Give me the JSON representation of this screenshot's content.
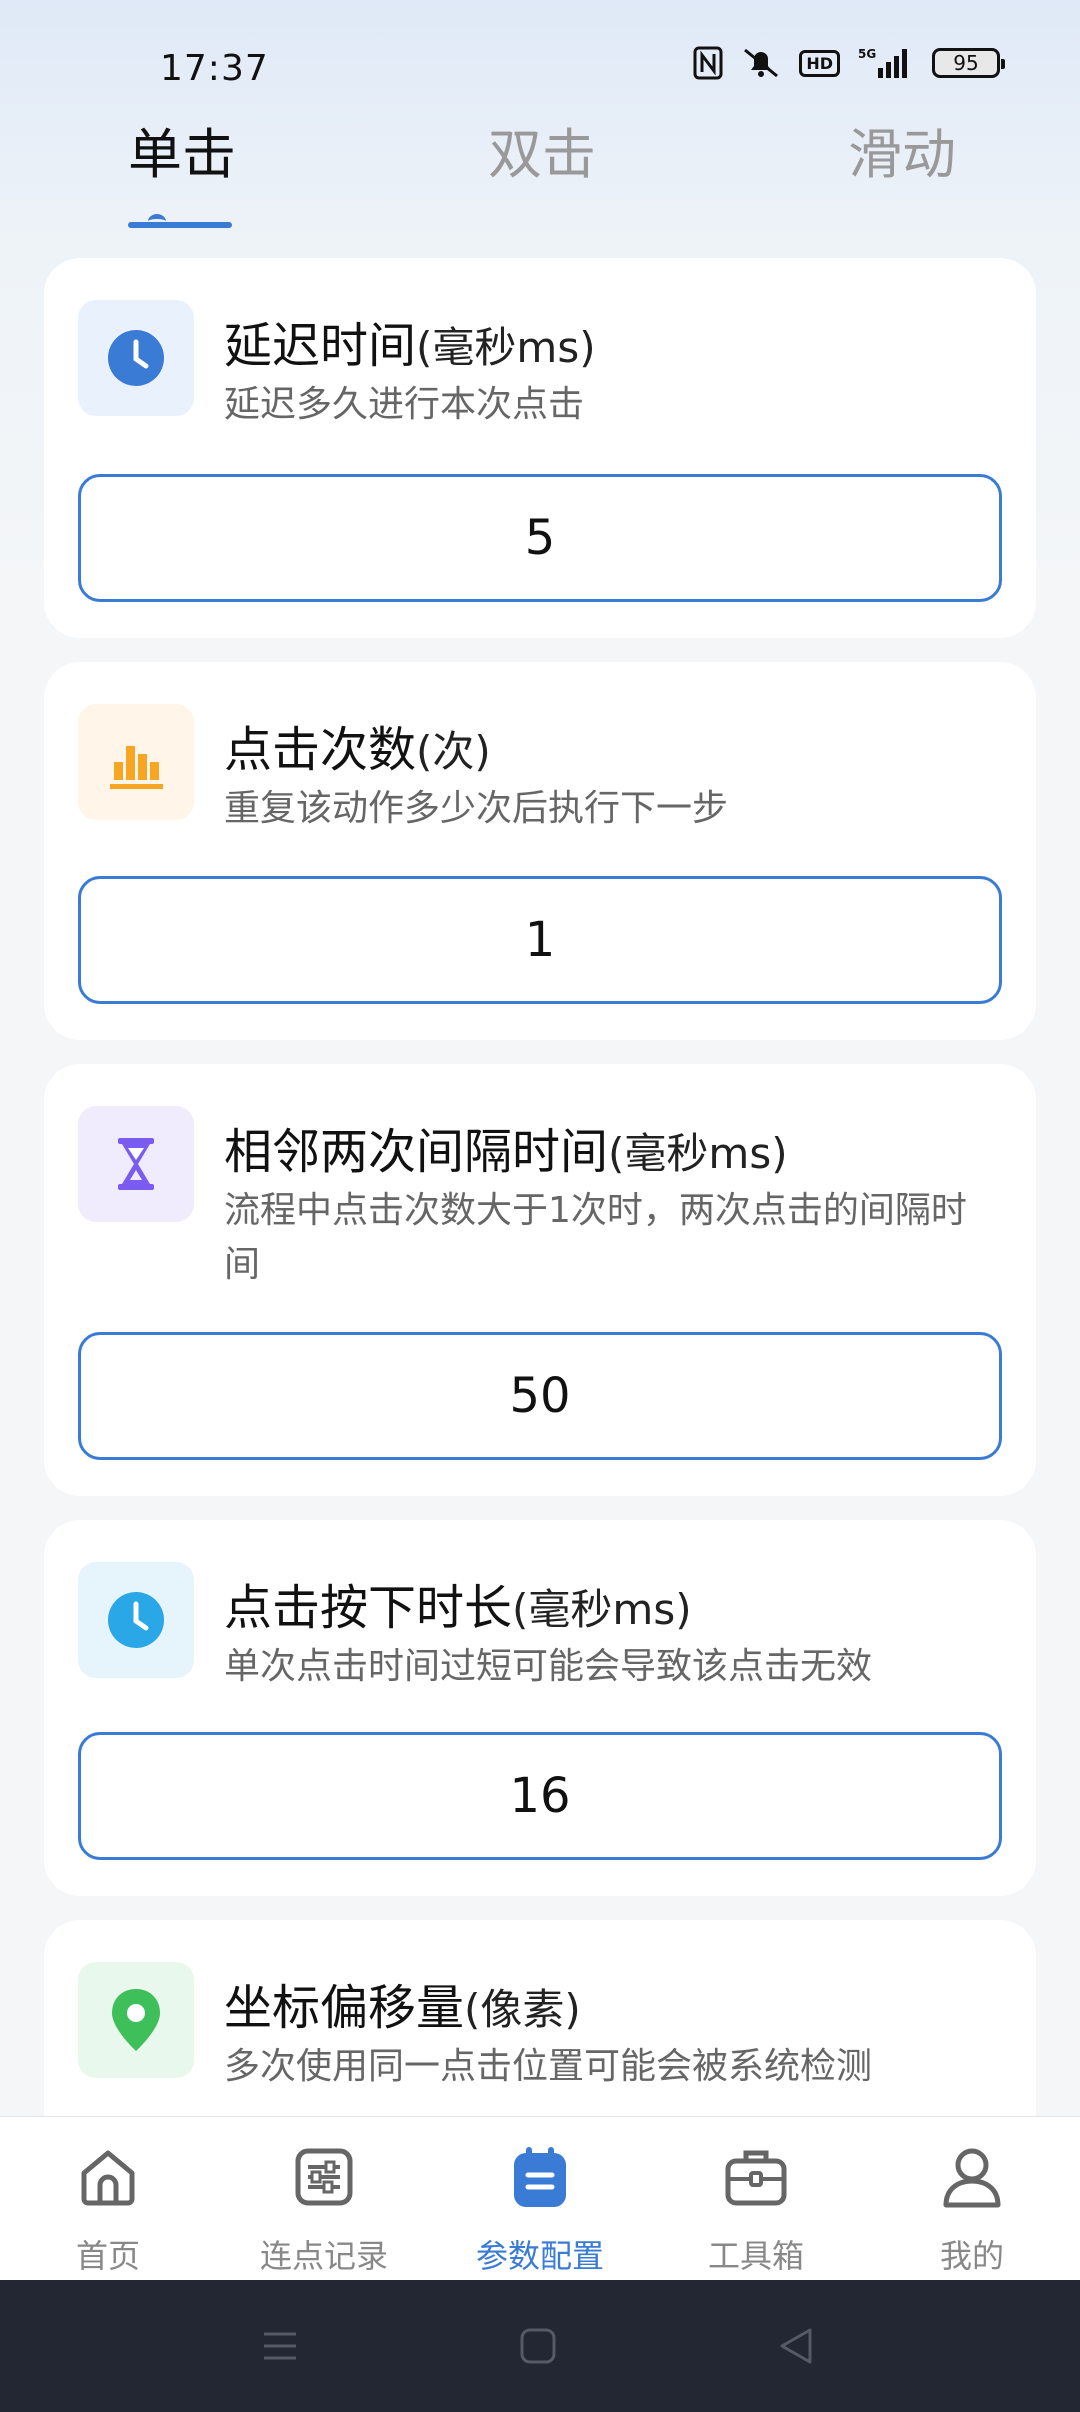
{
  "status_bar": {
    "time": "17:37",
    "battery": "95",
    "icons": [
      "nfc-icon",
      "mute-icon",
      "hd-icon",
      "5g-signal-icon",
      "battery-icon"
    ],
    "hd_label": "HD"
  },
  "tabs": [
    {
      "label": "单击",
      "active": true
    },
    {
      "label": "双击",
      "active": false
    },
    {
      "label": "滑动",
      "active": false
    }
  ],
  "cards": [
    {
      "title": "延迟时间",
      "unit": "(毫秒ms)",
      "desc": "延迟多久进行本次点击",
      "value": "5",
      "icon": "clock-icon",
      "icon_color": "#3a7bd5",
      "icon_bg": "#e9f1fd"
    },
    {
      "title": "点击次数",
      "unit": "(次)",
      "desc": "重复该动作多少次后执行下一步",
      "value": "1",
      "icon": "bar-chart-icon",
      "icon_color": "#f6a623",
      "icon_bg": "#fff5e8"
    },
    {
      "title": "相邻两次间隔时间",
      "unit": "(毫秒ms)",
      "desc": "流程中点击次数大于1次时，两次点击的间隔时间",
      "value": "50",
      "icon": "hourglass-icon",
      "icon_color": "#7a5cf0",
      "icon_bg": "#f0ecfd"
    },
    {
      "title": "点击按下时长",
      "unit": "(毫秒ms)",
      "desc": "单次点击时间过短可能会导致该点击无效",
      "value": "16",
      "icon": "clock-icon",
      "icon_color": "#2aa7e6",
      "icon_bg": "#e6f5fc"
    },
    {
      "title": "坐标偏移量",
      "unit": "(像素)",
      "desc": "多次使用同一点击位置可能会被系统检测",
      "icon": "location-pin-icon",
      "icon_color": "#3fbf5a",
      "icon_bg": "#e9f8ec"
    }
  ],
  "bottom_nav": [
    {
      "label": "首页",
      "icon": "home-icon",
      "active": false
    },
    {
      "label": "连点记录",
      "icon": "sliders-icon",
      "active": false
    },
    {
      "label": "参数配置",
      "icon": "config-icon",
      "active": true
    },
    {
      "label": "工具箱",
      "icon": "toolbox-icon",
      "active": false
    },
    {
      "label": "我的",
      "icon": "user-icon",
      "active": false
    }
  ],
  "colors": {
    "accent": "#3a7bd5",
    "inactive": "#888888",
    "system_nav_bg": "#232733"
  }
}
